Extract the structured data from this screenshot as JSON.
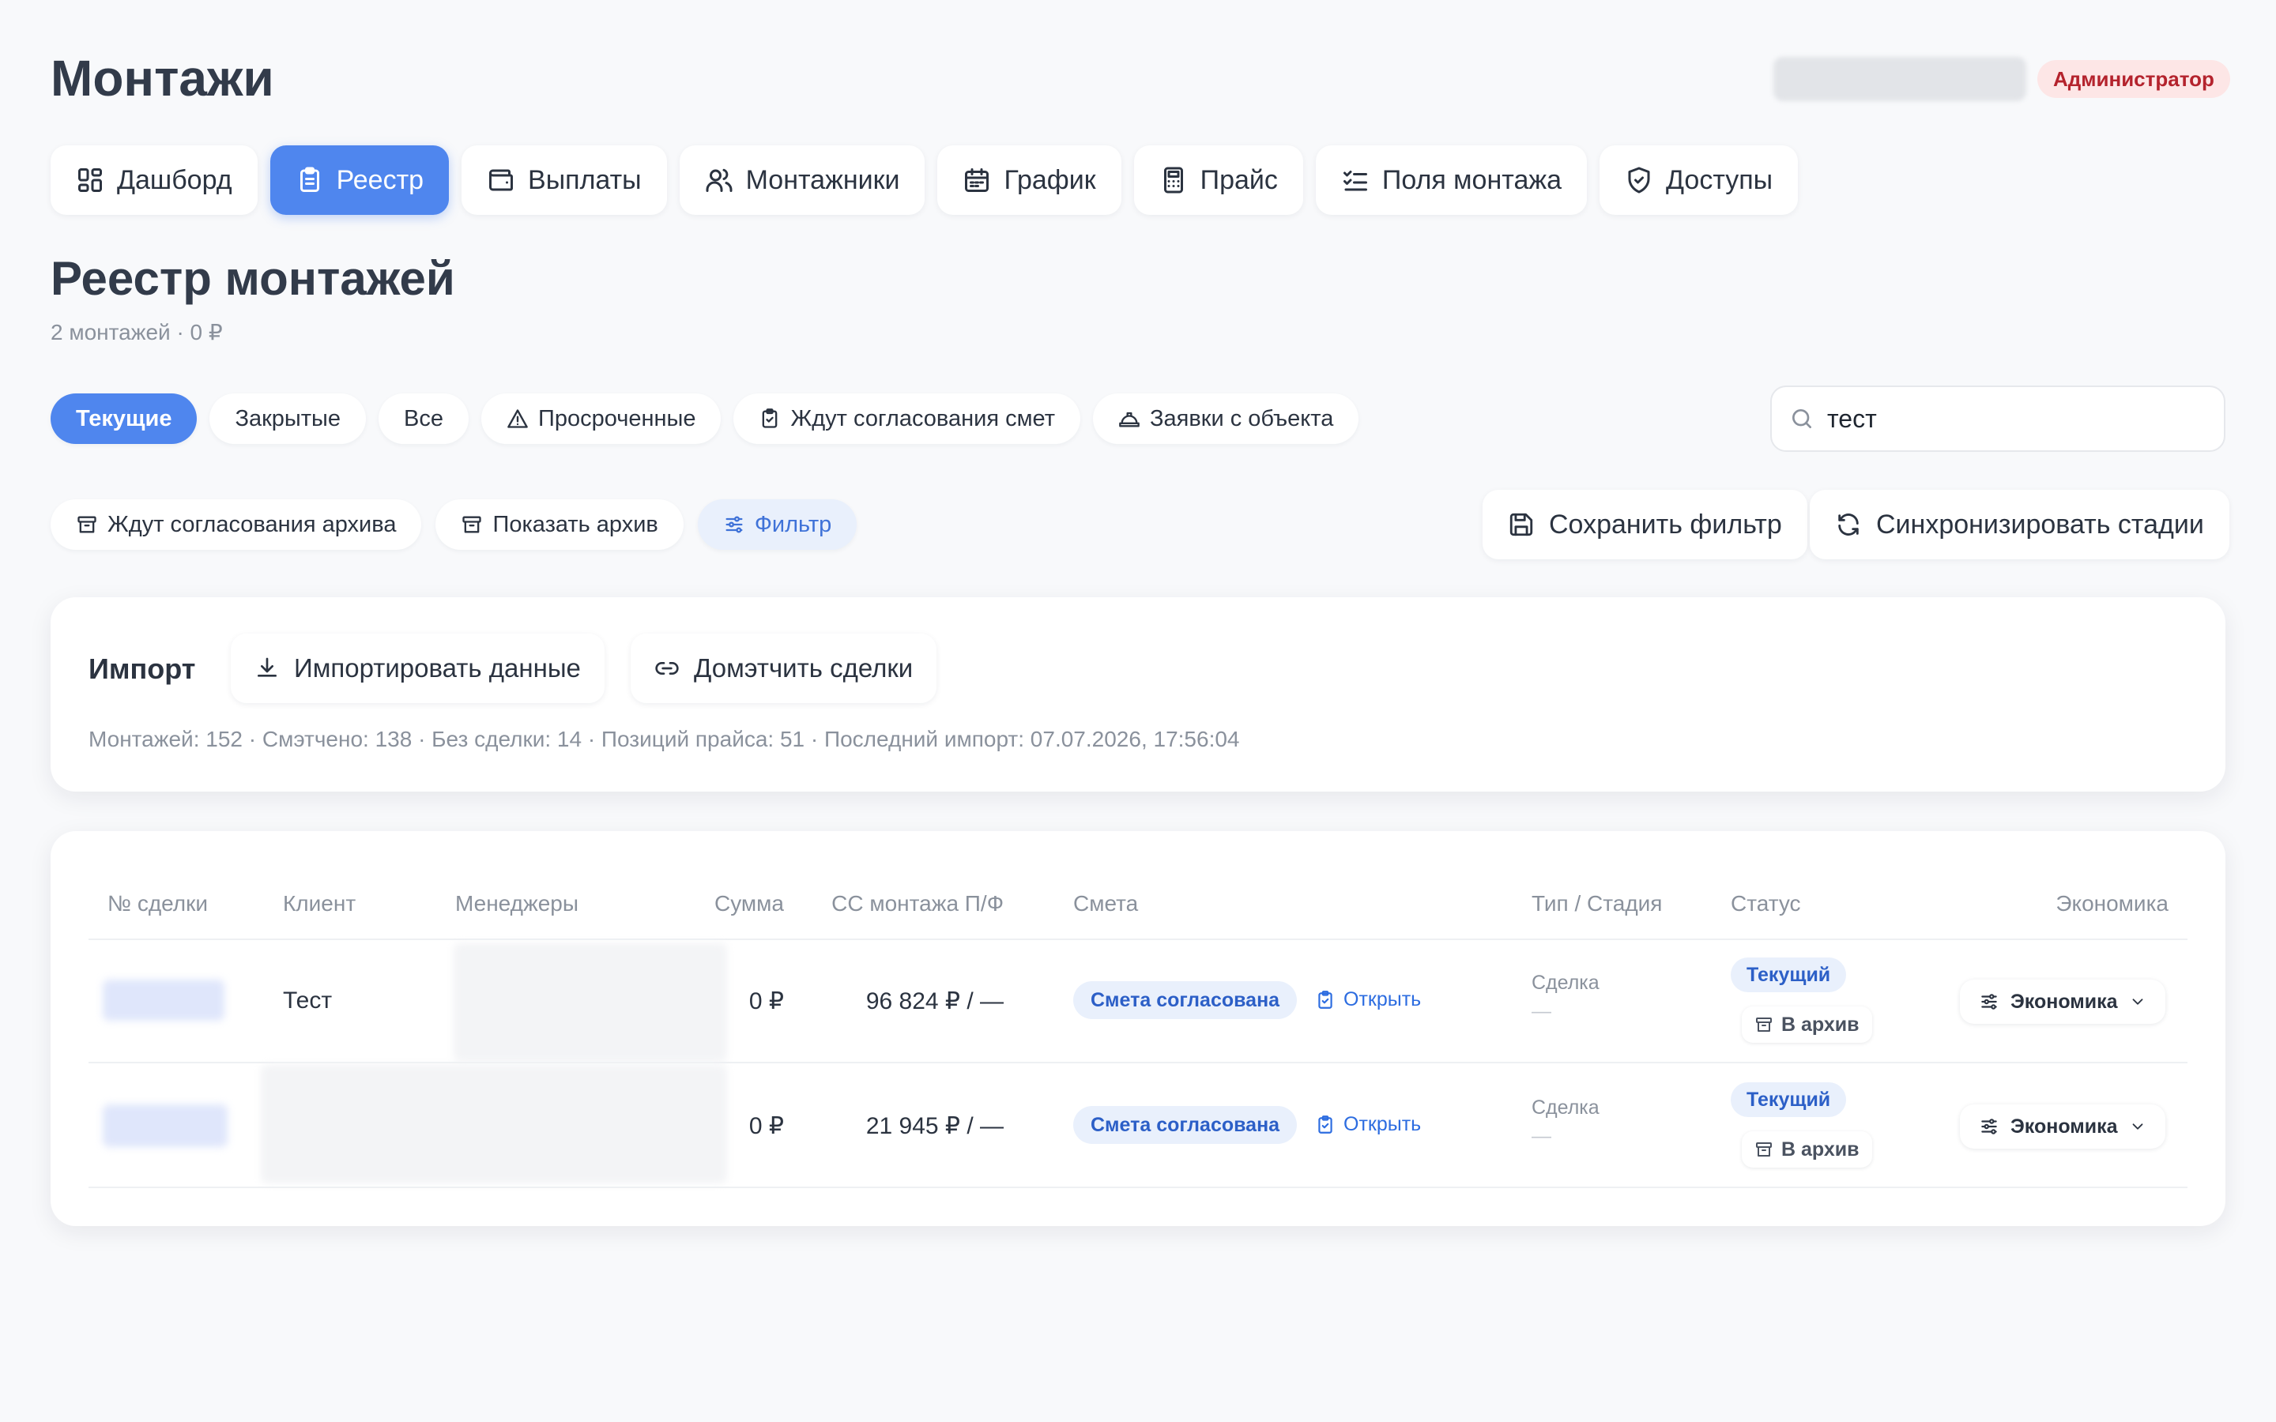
{
  "header": {
    "app_title": "Монтажи",
    "role_badge": "Администратор"
  },
  "nav": {
    "tabs": [
      {
        "label": "Дашборд",
        "icon": "dashboard-icon",
        "active": false
      },
      {
        "label": "Реестр",
        "icon": "clipboard-icon",
        "active": true
      },
      {
        "label": "Выплаты",
        "icon": "wallet-icon",
        "active": false
      },
      {
        "label": "Монтажники",
        "icon": "users-icon",
        "active": false
      },
      {
        "label": "График",
        "icon": "calendar-icon",
        "active": false
      },
      {
        "label": "Прайс",
        "icon": "calculator-icon",
        "active": false
      },
      {
        "label": "Поля монтажа",
        "icon": "list-check-icon",
        "active": false
      },
      {
        "label": "Доступы",
        "icon": "shield-icon",
        "active": false
      }
    ]
  },
  "page": {
    "title": "Реестр монтажей",
    "subtitle": "2 монтажей · 0 ₽"
  },
  "filters": {
    "row1": [
      {
        "label": "Текущие",
        "icon": "",
        "active": true
      },
      {
        "label": "Закрытые",
        "icon": "",
        "active": false
      },
      {
        "label": "Все",
        "icon": "",
        "active": false
      },
      {
        "label": "Просроченные",
        "icon": "warning-icon",
        "active": false
      },
      {
        "label": "Ждут согласования смет",
        "icon": "clipboard-check-icon",
        "active": false
      },
      {
        "label": "Заявки с объекта",
        "icon": "helmet-icon",
        "active": false
      }
    ],
    "row2": [
      {
        "label": "Ждут согласования архива",
        "icon": "archive-icon"
      },
      {
        "label": "Показать архив",
        "icon": "archive-icon"
      },
      {
        "label": "Фильтр",
        "icon": "sliders-icon"
      }
    ],
    "search_value": "тест",
    "save_filter_label": "Сохранить фильтр",
    "sync_stages_label": "Синхронизировать стадии"
  },
  "import": {
    "title": "Импорт",
    "import_button": "Импортировать данные",
    "match_button": "Домэтчить сделки",
    "stats": "Монтажей: 152 · Смэтчено: 138 · Без сделки: 14 · Позиций прайса: 51 · Последний импорт: 07.07.2026, 17:56:04"
  },
  "table": {
    "columns": {
      "deal": "№ сделки",
      "client": "Клиент",
      "managers": "Менеджеры",
      "sum": "Сумма",
      "cost": "СС монтажа П/Ф",
      "estimate": "Смета",
      "type_stage": "Тип / Стадия",
      "status": "Статус",
      "economy": "Экономика"
    },
    "rows": [
      {
        "client": "Тест",
        "sum": "0 ₽",
        "cost": "96 824 ₽ / —",
        "estimate_badge": "Смета согласована",
        "open_label": "Открыть",
        "type": "Сделка",
        "stage": "—",
        "status": "Текущий",
        "archive_label": "В архив",
        "economy_label": "Экономика"
      },
      {
        "client": "",
        "sum": "0 ₽",
        "cost": "21 945 ₽ / —",
        "estimate_badge": "Смета согласована",
        "open_label": "Открыть",
        "type": "Сделка",
        "stage": "—",
        "status": "Текущий",
        "archive_label": "В архив",
        "economy_label": "Экономика"
      }
    ]
  },
  "colors": {
    "accent": "#4f86ee",
    "background": "#f8f9fb",
    "admin_badge_bg": "#fde6e6",
    "admin_badge_text": "#b4232d",
    "status_badge_bg": "#e9f0fc"
  }
}
